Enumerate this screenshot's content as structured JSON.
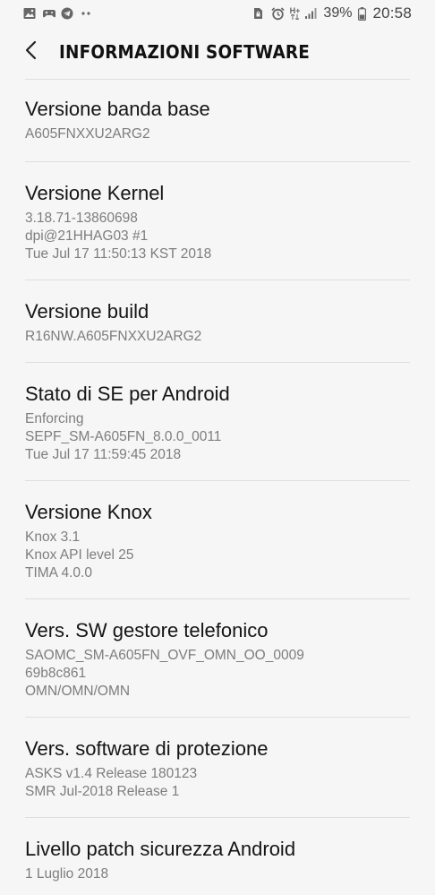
{
  "status_bar": {
    "left_icons": [
      "gallery-icon",
      "game-icon",
      "telegram-icon",
      "more-dots-icon"
    ],
    "right_icons": [
      "sim-lock-icon",
      "alarm-icon",
      "data-hplus-icon",
      "signal-icon",
      "battery-icon"
    ],
    "network_label": "H+",
    "battery_percent": "39%",
    "time": "20:58"
  },
  "header": {
    "title": "INFORMAZIONI SOFTWARE"
  },
  "items": [
    {
      "title": "Versione banda base",
      "lines": [
        "A605FNXXU2ARG2"
      ]
    },
    {
      "title": "Versione Kernel",
      "lines": [
        "3.18.71-13860698",
        "dpi@21HHAG03 #1",
        "Tue Jul 17 11:50:13 KST 2018"
      ]
    },
    {
      "title": "Versione build",
      "lines": [
        "R16NW.A605FNXXU2ARG2"
      ]
    },
    {
      "title": "Stato di SE per Android",
      "lines": [
        "Enforcing",
        "SEPF_SM-A605FN_8.0.0_0011",
        "Tue Jul 17 11:59:45 2018"
      ]
    },
    {
      "title": "Versione Knox",
      "lines": [
        "Knox 3.1",
        "Knox API level 25",
        "TIMA 4.0.0"
      ]
    },
    {
      "title": "Vers. SW gestore telefonico",
      "lines": [
        "SAOMC_SM-A605FN_OVF_OMN_OO_0009",
        "69b8c861",
        "OMN/OMN/OMN"
      ]
    },
    {
      "title": "Vers. software di protezione",
      "lines": [
        "ASKS v1.4 Release 180123",
        "SMR Jul-2018 Release 1"
      ]
    },
    {
      "title": "Livello patch sicurezza Android",
      "lines": [
        "1 Luglio 2018"
      ]
    }
  ]
}
